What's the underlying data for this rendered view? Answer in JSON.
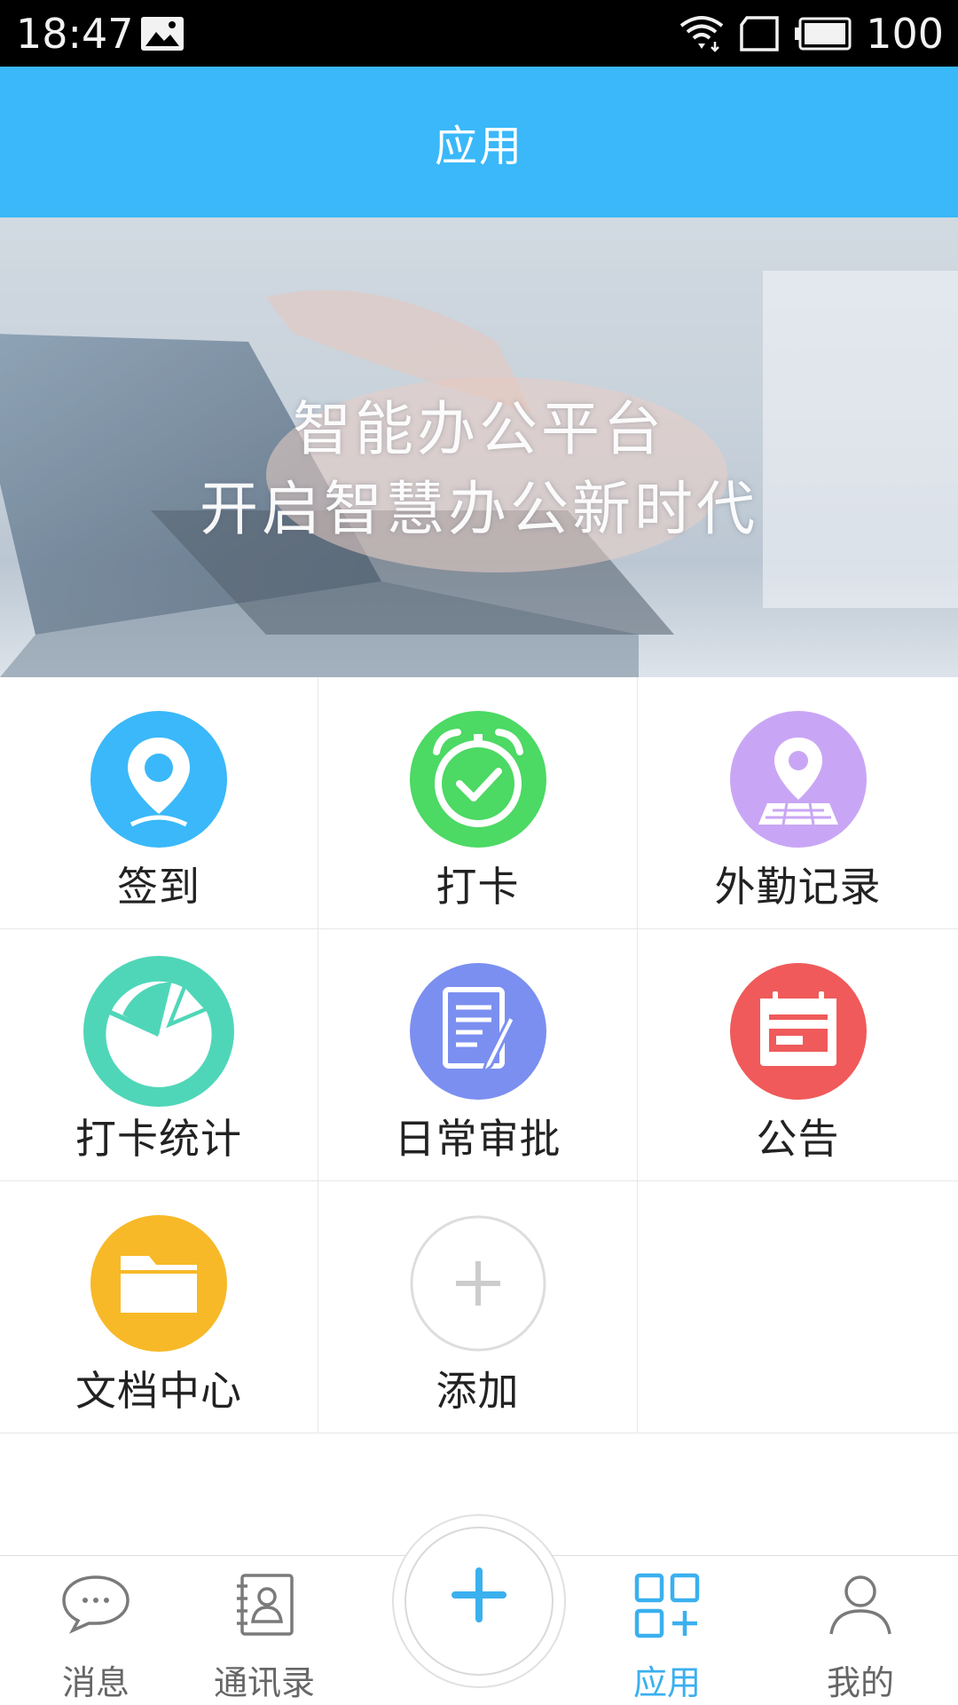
{
  "status_bar": {
    "time": "18:47",
    "battery": "100"
  },
  "header": {
    "title": "应用"
  },
  "banner": {
    "line1": "智能办公平台",
    "line2": "开启智慧办公新时代"
  },
  "apps": [
    {
      "label": "签到",
      "icon": "location-pin-icon",
      "color": "#3ab8f9"
    },
    {
      "label": "打卡",
      "icon": "alarm-clock-check-icon",
      "color": "#4cd964"
    },
    {
      "label": "外勤记录",
      "icon": "map-pin-icon",
      "color": "#c9a6f5"
    },
    {
      "label": "打卡统计",
      "icon": "pie-chart-icon",
      "color": "#4fd6b8"
    },
    {
      "label": "日常审批",
      "icon": "document-pen-icon",
      "color": "#7b8ff0"
    },
    {
      "label": "公告",
      "icon": "calendar-notice-icon",
      "color": "#f05a5a"
    },
    {
      "label": "文档中心",
      "icon": "folder-icon",
      "color": "#f7b928"
    },
    {
      "label": "添加",
      "icon": "plus-icon",
      "color": "#cccccc"
    }
  ],
  "nav": {
    "items": [
      {
        "label": "消息",
        "icon": "chat-bubble-icon"
      },
      {
        "label": "通讯录",
        "icon": "contacts-book-icon"
      },
      {
        "label": "应用",
        "icon": "apps-grid-icon",
        "active": true
      },
      {
        "label": "我的",
        "icon": "person-icon"
      }
    ],
    "fab_icon": "plus-icon",
    "active_color": "#3ab0ef"
  }
}
